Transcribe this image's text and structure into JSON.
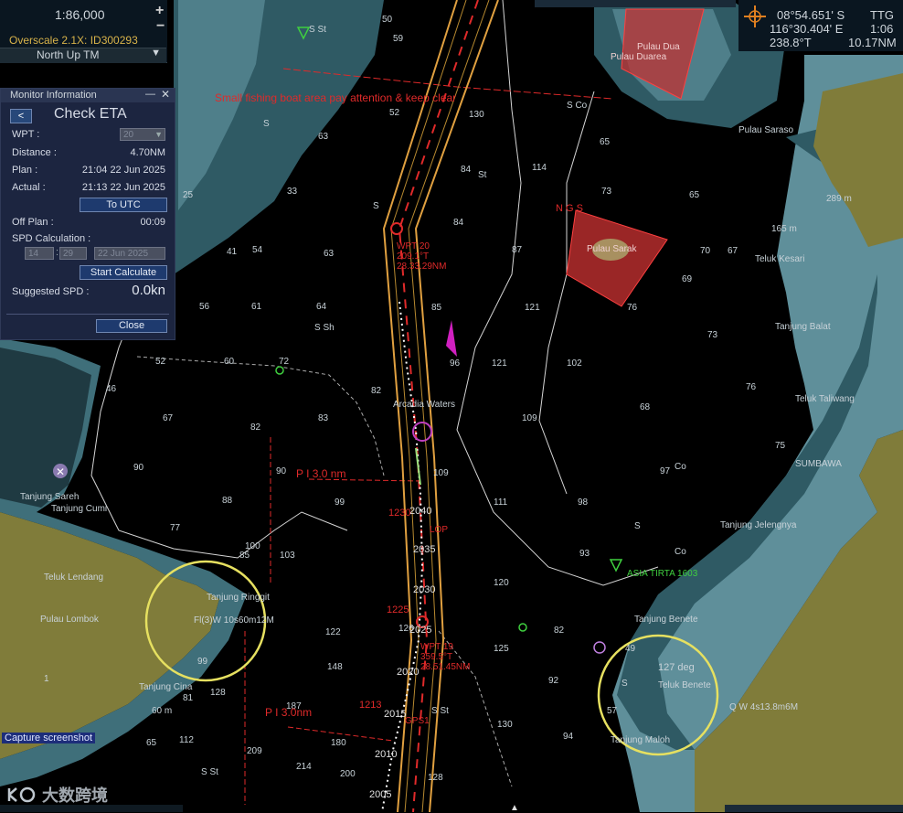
{
  "scale": {
    "value": "1:86,000",
    "zoom_in": "+",
    "zoom_out": "−",
    "overscale": "Overscale 2.1X: ID300293",
    "orientation": "North  Up TM"
  },
  "readout": {
    "lat": "08°54.651' S",
    "lon": "116°30.404' E",
    "bearing": "238.8°T",
    "ttg_label": "TTG",
    "ttg_value": "1:06",
    "distance": "10.17NM"
  },
  "monitor": {
    "title": "Monitor Information",
    "heading": "Check ETA",
    "back": "<",
    "wpt_label": "WPT :",
    "wpt_value": "20",
    "distance_label": "Distance :",
    "distance_value": "4.70NM",
    "plan_label": "Plan :",
    "plan_value": "21:04 22 Jun 2025",
    "actual_label": "Actual :",
    "actual_value": "21:13 22 Jun 2025",
    "to_utc": "To UTC",
    "off_plan_label": "Off Plan :",
    "off_plan_value": "00:09",
    "spd_calc_label": "SPD Calculation :",
    "spd_hh": "14",
    "spd_mm": "29",
    "spd_date": "22 Jun 2025",
    "start_calc": "Start Calculate",
    "suggested_label": "Suggested SPD :",
    "suggested_value": "0.0kn",
    "close": "Close"
  },
  "map_labels": {
    "fishing_warning": "Small fishing boat area pay attention & keep clear",
    "pulau_dua": "Pulau Dua",
    "pulau_duarea": "Pulau Duarea",
    "pulau_saraso": "Pulau Saraso",
    "pulau_sarak": "Pulau Sarak",
    "ngs": "N G S",
    "wpt20": "WPT 20",
    "wpt20_course": "209.1°T",
    "wpt20_dist": "28.33.29NM",
    "arcadia": "Arcadia Waters",
    "pi_upper": "P I  3.0 nm",
    "pi_lower": "P I  3.0nm",
    "lop": "LOP",
    "gps1": "GPS1",
    "wpt19": "WPT 19",
    "wpt19_course": "359.5°T",
    "wpt19_dist": "28.51.45NM",
    "asia_tirta": "ASIA TIRTA 1603",
    "teluk_kesari": "Teluk Kesari",
    "tanjung_balat": "Tanjung Balat",
    "teluk_taliwang": "Teluk Taliwang",
    "sumbawa": "SUMBAWA",
    "tanjung_jelengnya": "Tanjung Jelengnya",
    "tanjung_benete": "Tanjung Benete",
    "teluk_benete": "Teluk Benete",
    "tanjung_maloh": "Tanjung Maloh",
    "deg127": "127 deg",
    "light_right": "Q W 4s13.8m6M",
    "light_left": "Fl(3)W 10s60m12M",
    "pulau_lombok": "Pulau Lombok",
    "teluk_lendang": "Teluk Lendang",
    "tanjung_ringgit": "Tanjung Ringgit",
    "tanjung_cina": "Tanjung Cina",
    "tanjung_kiri": "Tanjung Cumi",
    "tanjung_sareh": "Tanjung Sareh",
    "sr_co": "S Co",
    "m289": "289 m",
    "m165": "165 m",
    "m60": "60 m",
    "s_st": "S St",
    "s_sh": "S Sh",
    "co": "Co",
    "st": "St",
    "s": "S"
  },
  "capture": "Capture screenshot",
  "watermark": "大数跨境",
  "colors": {
    "land": "#807c3a",
    "shallow": "#5f8f9a",
    "mid": "#2f5a64",
    "deep": "#000000",
    "route": "#e0a040",
    "danger": "#e02a2a"
  }
}
